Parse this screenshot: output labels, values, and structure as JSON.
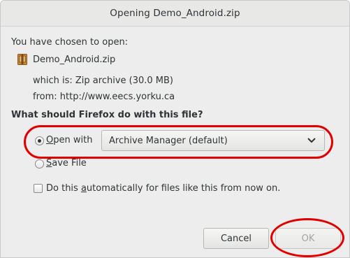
{
  "window": {
    "title": "Opening Demo_Android.zip"
  },
  "info": {
    "chosen_label": "You have chosen to open:",
    "file_icon": "zip-file-icon",
    "file_name": "Demo_Android.zip",
    "which_is": "which is: Zip archive (30.0 MB)",
    "from": "from: http://www.eecs.yorku.ca"
  },
  "question": "What should Firefox do with this file?",
  "options": {
    "open_with": {
      "label_mnemonic": "O",
      "label_rest": "pen with",
      "selected": true,
      "app": "Archive Manager (default)"
    },
    "save_file": {
      "label_mnemonic": "S",
      "label_rest": "ave File",
      "selected": false
    }
  },
  "auto_checkbox": {
    "label_prefix": "Do this ",
    "label_mnemonic": "a",
    "label_rest": "utomatically for files like this from now on.",
    "checked": false
  },
  "buttons": {
    "cancel": "Cancel",
    "ok": "OK",
    "ok_enabled": false
  },
  "annotation_color": "#e00000"
}
